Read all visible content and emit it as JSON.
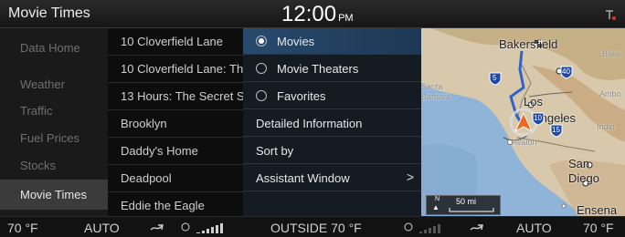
{
  "status": {
    "app_title": "Movie Times",
    "time": "12:00",
    "ampm": "PM"
  },
  "sidebar": {
    "items": [
      "Data Home",
      "Weather",
      "Traffic",
      "Fuel Prices",
      "Stocks",
      "Movie Times"
    ]
  },
  "movies": [
    "10 Cloverfield Lane",
    "10 Cloverfield Lane: Th",
    "13 Hours: The Secret S",
    "Brooklyn",
    "Daddy's Home",
    "Deadpool",
    "Eddie the Eagle"
  ],
  "menu": {
    "radios": [
      "Movies",
      "Movie Theaters",
      "Favorites"
    ],
    "actions": [
      "Detailed Information",
      "Sort by",
      "Assistant Window"
    ]
  },
  "map": {
    "labels": [
      "Bakersfield",
      "Bake",
      "Santa",
      "Barbara",
      "Los",
      "Angeles",
      "Ambo",
      "Indio",
      "Avalon",
      "San",
      "Diego",
      "Ensena"
    ],
    "shields": [
      "5",
      "40",
      "10",
      "15"
    ],
    "scale": "50 mi",
    "north": "N"
  },
  "climate": {
    "left_temp": "70 °F",
    "left_mode": "AUTO",
    "outside": "OUTSIDE  70 °F",
    "right_mode": "AUTO",
    "right_temp": "70 °F"
  }
}
